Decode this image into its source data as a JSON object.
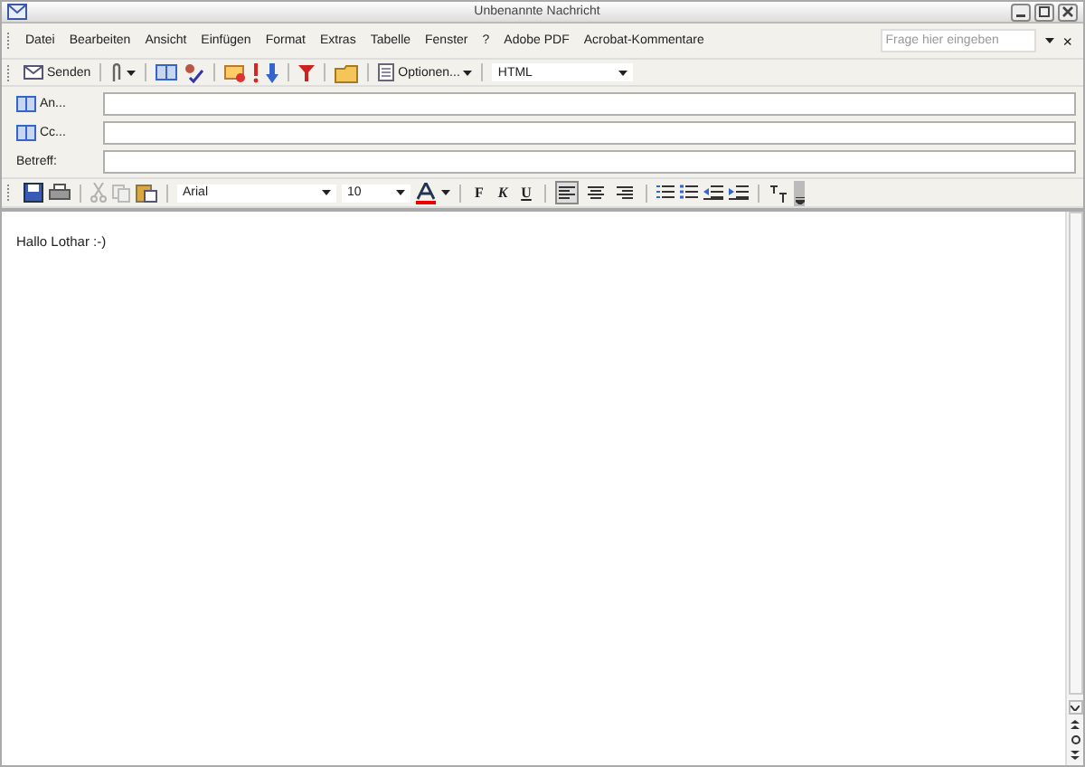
{
  "window": {
    "title": "Unbenannte Nachricht"
  },
  "menu": [
    "Datei",
    "Bearbeiten",
    "Ansicht",
    "Einfügen",
    "Format",
    "Extras",
    "Tabelle",
    "Fenster",
    "?",
    "Adobe PDF",
    "Acrobat-Kommentare"
  ],
  "help": {
    "placeholder": "Frage hier eingeben",
    "close": "×"
  },
  "toolbar": {
    "send": "Senden",
    "options": "Optionen...",
    "format": "HTML"
  },
  "fields": [
    {
      "label": "An...",
      "kind": "address"
    },
    {
      "label": "Cc...",
      "kind": "address"
    },
    {
      "label": "Betreff:",
      "kind": "plain"
    }
  ],
  "format_bar": {
    "font": "Arial",
    "size": "10",
    "bold": "F",
    "italic": "K",
    "underline": "U",
    "align": [
      {
        "selected": true
      },
      {
        "selected": false
      },
      {
        "selected": false
      }
    ]
  },
  "body": {
    "text": "Hallo Lothar :-)"
  }
}
